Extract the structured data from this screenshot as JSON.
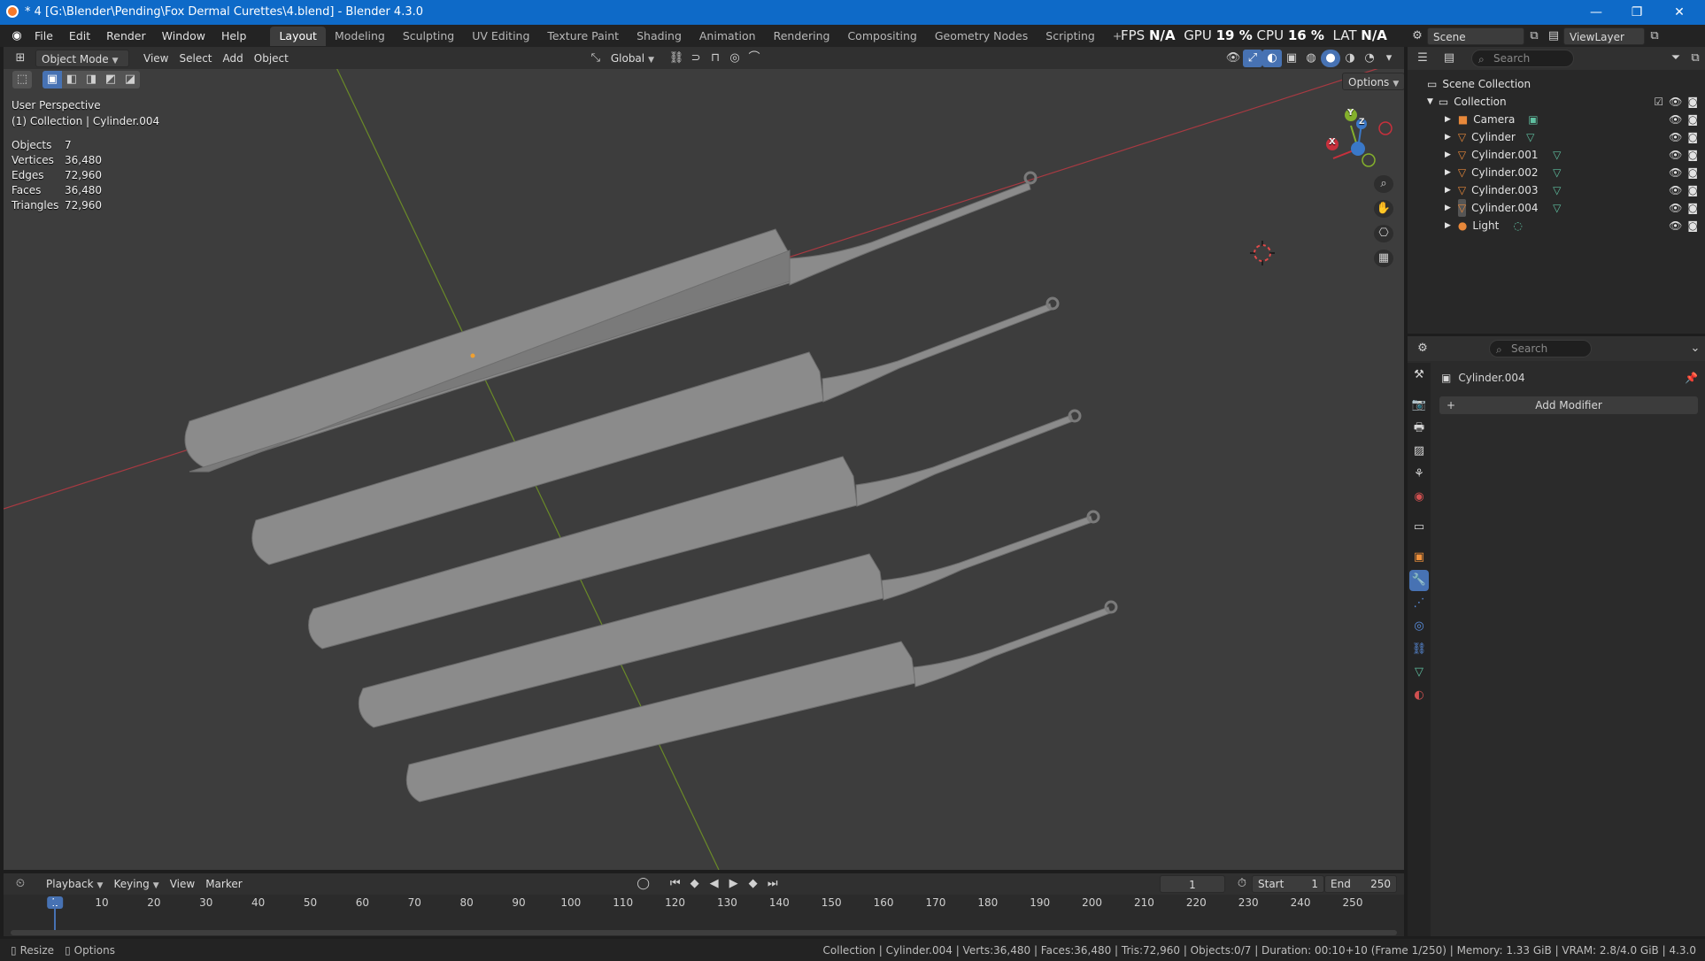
{
  "window": {
    "title": "* 4 [G:\\Blender\\Pending\\Fox Dermal Curettes\\4.blend] - Blender 4.3.0",
    "minimize": "—",
    "maximize": "❐",
    "close": "✕"
  },
  "menu": {
    "items": [
      "File",
      "Edit",
      "Render",
      "Window",
      "Help"
    ],
    "workspaces": [
      "Layout",
      "Modeling",
      "Sculpting",
      "UV Editing",
      "Texture Paint",
      "Shading",
      "Animation",
      "Rendering",
      "Compositing",
      "Geometry Nodes",
      "Scripting"
    ],
    "active_workspace": "Layout",
    "add_workspace": "+"
  },
  "perf": {
    "fps_label": "FPS",
    "fps": "N/A",
    "gpu_label": "GPU",
    "gpu": "19 %",
    "cpu_label": "CPU",
    "cpu": "16 %",
    "lat_label": "LAT",
    "lat": "N/A"
  },
  "scene": {
    "scene_name": "Scene",
    "viewlayer_name": "ViewLayer"
  },
  "viewport_header": {
    "mode": "Object Mode",
    "menus": [
      "View",
      "Select",
      "Add",
      "Object"
    ],
    "orientation": "Global",
    "options_label": "Options"
  },
  "viewport": {
    "view_name": "User Perspective",
    "context": "(1) Collection | Cylinder.004",
    "stats": [
      {
        "label": "Objects",
        "value": "7"
      },
      {
        "label": "Vertices",
        "value": "36,480"
      },
      {
        "label": "Edges",
        "value": "72,960"
      },
      {
        "label": "Faces",
        "value": "36,480"
      },
      {
        "label": "Triangles",
        "value": "72,960"
      }
    ],
    "gizmo": {
      "x": "X",
      "y": "Y",
      "z": "Z"
    }
  },
  "outliner": {
    "search_placeholder": "Search",
    "scene_collection": "Scene Collection",
    "collection": "Collection",
    "items": [
      {
        "name": "Camera",
        "type": "camera"
      },
      {
        "name": "Cylinder",
        "type": "mesh"
      },
      {
        "name": "Cylinder.001",
        "type": "mesh"
      },
      {
        "name": "Cylinder.002",
        "type": "mesh"
      },
      {
        "name": "Cylinder.003",
        "type": "mesh"
      },
      {
        "name": "Cylinder.004",
        "type": "mesh"
      },
      {
        "name": "Light",
        "type": "light"
      }
    ]
  },
  "properties": {
    "search_placeholder": "Search",
    "object_name": "Cylinder.004",
    "add_modifier": "Add Modifier"
  },
  "timeline": {
    "menus": [
      "Playback",
      "Keying",
      "View",
      "Marker"
    ],
    "current_frame": "1",
    "start_label": "Start",
    "start": "1",
    "end_label": "End",
    "end": "250",
    "ticks": [
      "1",
      "10",
      "20",
      "30",
      "40",
      "50",
      "60",
      "70",
      "80",
      "90",
      "100",
      "110",
      "120",
      "130",
      "140",
      "150",
      "160",
      "170",
      "180",
      "190",
      "200",
      "210",
      "220",
      "230",
      "240",
      "250"
    ]
  },
  "statusbar": {
    "resize": "Resize",
    "options": "Options",
    "info": "Collection | Cylinder.004 | Verts:36,480 | Faces:36,480 | Tris:72,960 | Objects:0/7 | Duration: 00:10+10 (Frame 1/250) | Memory: 1.33 GiB | VRAM: 2.8/4.0 GiB | 4.3.0"
  },
  "colors": {
    "accent": "#0e6ac8",
    "x_axis": "#c8303c",
    "y_axis": "#84b02c",
    "z_axis": "#3a78c8",
    "viewport_bg": "#3d3d3d",
    "selected_row": "#334d80"
  }
}
